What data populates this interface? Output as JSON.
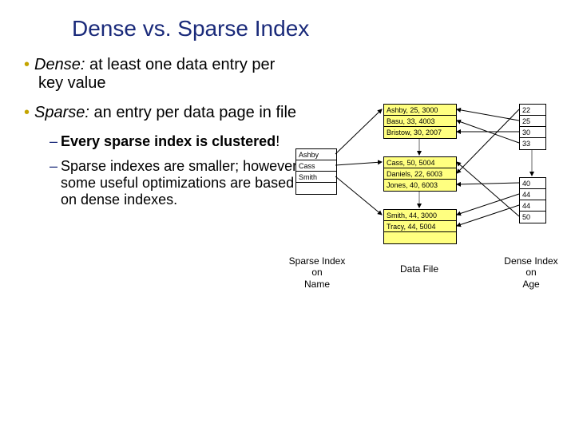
{
  "title": "Dense vs. Sparse Index",
  "bullets": {
    "dense": {
      "term": "Dense:",
      "rest": "  at least one data entry per key value"
    },
    "sparse": {
      "term": "Sparse:",
      "rest": " an entry per data page in file"
    },
    "sub1a": "Every sparse index is ",
    "sub1b": "clustered",
    "sub1c": "!",
    "sub2": "Sparse indexes are smaller; however, some useful optimizations are based on dense indexes."
  },
  "sparse_index": [
    "Ashby",
    "Cass",
    "Smith"
  ],
  "data_file": [
    "Ashby, 25, 3000",
    "Basu, 33, 4003",
    "Bristow, 30, 2007",
    "Cass, 50, 5004",
    "Daniels, 22, 6003",
    "Jones, 40, 6003",
    "Smith, 44, 3000",
    "Tracy, 44, 5004"
  ],
  "dense_index": [
    "22",
    "25",
    "30",
    "33",
    "40",
    "44",
    "44",
    "50"
  ],
  "labels": {
    "sparse": "Sparse Index on Name",
    "data": "Data File",
    "dense": "Dense Index on Age"
  }
}
